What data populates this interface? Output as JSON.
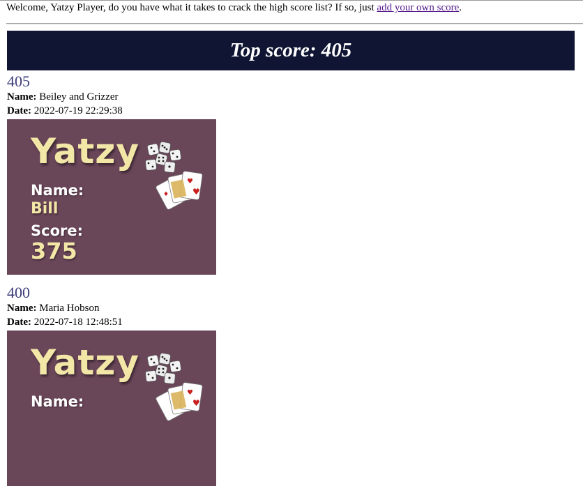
{
  "intro": {
    "text": "Welcome, Yatzy Player, do you have what it takes to crack the high score list? If so, just ",
    "link": "add your own score",
    "suffix": "."
  },
  "banner": {
    "title": "Top score: 405"
  },
  "entries": [
    {
      "score": "405",
      "name_label": "Name:",
      "name": "Beiley and Grizzer",
      "date_label": "Date:",
      "date": "2022-07-19 22:29:38",
      "card": {
        "title": "Yatzy",
        "name_label": "Name:",
        "name": "Bill",
        "score_label": "Score:",
        "score": "375"
      }
    },
    {
      "score": "400",
      "name_label": "Name:",
      "name": "Maria Hobson",
      "date_label": "Date:",
      "date": "2022-07-18 12:48:51",
      "card": {
        "title": "Yatzy",
        "name_label": "Name:"
      }
    }
  ],
  "colors": {
    "banner_bg": "#0f1533",
    "card_bg": "#6a4659",
    "card_accent": "#f3e7a8",
    "score_text": "#3a3d7a",
    "link": "#551a8b"
  }
}
